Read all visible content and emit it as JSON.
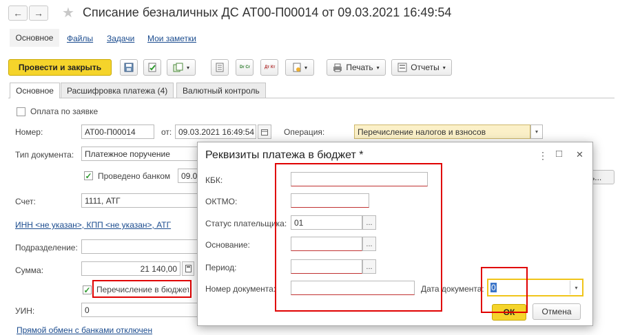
{
  "window": {
    "title": "Списание безналичных ДС АТ00-П00014 от 09.03.2021 16:49:54",
    "back_arrow": "←",
    "forward_arrow": "→",
    "star": "★"
  },
  "nav_tabs": [
    "Основное",
    "Файлы",
    "Задачи",
    "Мои заметки"
  ],
  "toolbar": {
    "post_close": "Провести и закрыть",
    "print": "Печать",
    "reports": "Отчеты",
    "dr_cr": "Dr Cr",
    "dt_kt": "Дт Кт"
  },
  "form_tabs": [
    "Основное",
    "Расшифровка платежа (4)",
    "Валютный контроль"
  ],
  "form": {
    "pay_by_request": "Оплата по заявке",
    "number_label": "Номер:",
    "number_value": "АТ00-П00014",
    "from_label": "от:",
    "date_value": "09.03.2021 16:49:54",
    "operation_label": "Операция:",
    "operation_value": "Перечисление налогов и взносов",
    "doc_type_label": "Тип документа:",
    "doc_type_value": "Платежное поручение",
    "bank_posted": "Проведено банком",
    "bank_date": "09.0",
    "account_label": "Счет:",
    "account_value": "1111, АТГ",
    "inn_link": "ИНН <не указан>, КПП <не указан>, АТГ",
    "division_label": "Подразделение:",
    "sum_label": "Сумма:",
    "sum_value": "21 140,00",
    "budget_transfer": "Перечисление в бюджет",
    "uin_label": "УИН:",
    "uin_value": "0",
    "exchange_link": "Прямой обмен с банками отключен",
    "right_partial": "ь..."
  },
  "dialog": {
    "title": "Реквизиты платежа в бюджет *",
    "kbk_label": "КБК:",
    "oktmo_label": "ОКТМО:",
    "status_label": "Статус плательщика:",
    "status_value": "01",
    "basis_label": "Основание:",
    "period_label": "Период:",
    "doc_number_label": "Номер документа:",
    "doc_date_label": "Дата документа:",
    "doc_date_value": "0",
    "ok": "ОК",
    "cancel": "Отмена",
    "more": "⋮",
    "maximize": "□",
    "close": "✕",
    "dots": "..."
  }
}
